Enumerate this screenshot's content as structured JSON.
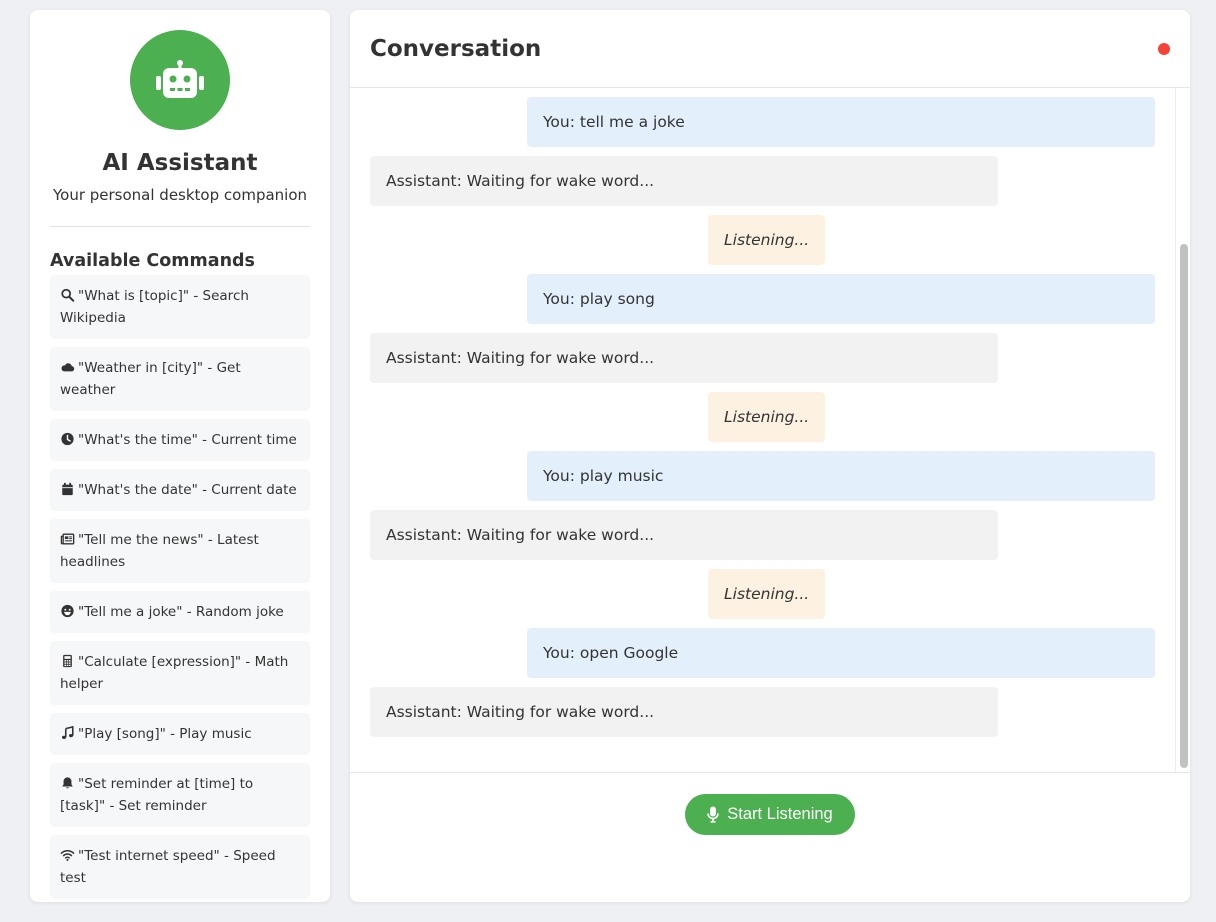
{
  "sidebar": {
    "title": "AI Assistant",
    "subtitle": "Your personal desktop companion",
    "commands_title": "Available Commands",
    "commands": [
      {
        "icon": "search-icon",
        "text": "\"What is [topic]\" - Search Wikipedia"
      },
      {
        "icon": "cloud-icon",
        "text": "\"Weather in [city]\" - Get weather"
      },
      {
        "icon": "clock-icon",
        "text": "\"What's the time\" - Current time"
      },
      {
        "icon": "calendar-icon",
        "text": "\"What's the date\" - Current date"
      },
      {
        "icon": "newspaper-icon",
        "text": "\"Tell me the news\" - Latest headlines"
      },
      {
        "icon": "smile-icon",
        "text": "\"Tell me a joke\" - Random joke"
      },
      {
        "icon": "calculator-icon",
        "text": "\"Calculate [expression]\" - Math helper"
      },
      {
        "icon": "music-icon",
        "text": "\"Play [song]\" - Play music"
      },
      {
        "icon": "bell-icon",
        "text": "\"Set reminder at [time] to [task]\" - Set reminder"
      },
      {
        "icon": "wifi-icon",
        "text": "\"Test internet speed\" - Speed test"
      }
    ]
  },
  "main": {
    "title": "Conversation",
    "status_color": "#f44336",
    "messages": [
      {
        "role": "user",
        "text": "You: tell me a joke"
      },
      {
        "role": "assistant",
        "text": "Assistant: Waiting for wake word..."
      },
      {
        "role": "status",
        "text": "Listening..."
      },
      {
        "role": "user",
        "text": "You: play song"
      },
      {
        "role": "assistant",
        "text": "Assistant: Waiting for wake word..."
      },
      {
        "role": "status",
        "text": "Listening..."
      },
      {
        "role": "user",
        "text": "You: play music"
      },
      {
        "role": "assistant",
        "text": "Assistant: Waiting for wake word..."
      },
      {
        "role": "status",
        "text": "Listening..."
      },
      {
        "role": "user",
        "text": "You: open Google"
      },
      {
        "role": "assistant",
        "text": "Assistant: Waiting for wake word..."
      }
    ],
    "listen_button": "Start Listening"
  },
  "colors": {
    "accent": "#4caf50",
    "user_bubble": "#e3f0fc",
    "assistant_bubble": "#f2f2f2",
    "status_bubble": "#fdf1e2"
  }
}
